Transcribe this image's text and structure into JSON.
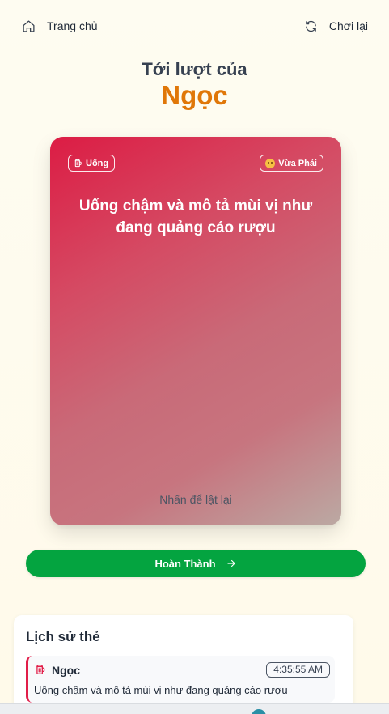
{
  "nav": {
    "home_label": "Trang chủ",
    "replay_label": "Chơi lại"
  },
  "turn": {
    "label": "Tới lượt của",
    "player": "Ngọc"
  },
  "card": {
    "type_badge": "Uống",
    "level_badge": "Vừa Phải",
    "text": "Uống chậm và mô tả mùi vị như đang quảng cáo rượu",
    "hint": "Nhấn để lật lại"
  },
  "actions": {
    "done_label": "Hoàn Thành"
  },
  "history": {
    "title": "Lịch sử thẻ",
    "items": [
      {
        "player": "Ngọc",
        "time": "4:35:55 AM",
        "text": "Uống chậm và mô tả mùi vị như đang quảng cáo rượu"
      }
    ]
  },
  "colors": {
    "accent_orange": "#e07708",
    "card_red": "#dc1c44",
    "done_green": "#04a440",
    "history_border": "#e11d48"
  },
  "icons": {
    "home": "home-icon",
    "replay": "refresh-icon",
    "drink": "beer-mug-icon",
    "level": "smiley-emoji-icon",
    "arrow": "arrow-right-icon"
  }
}
